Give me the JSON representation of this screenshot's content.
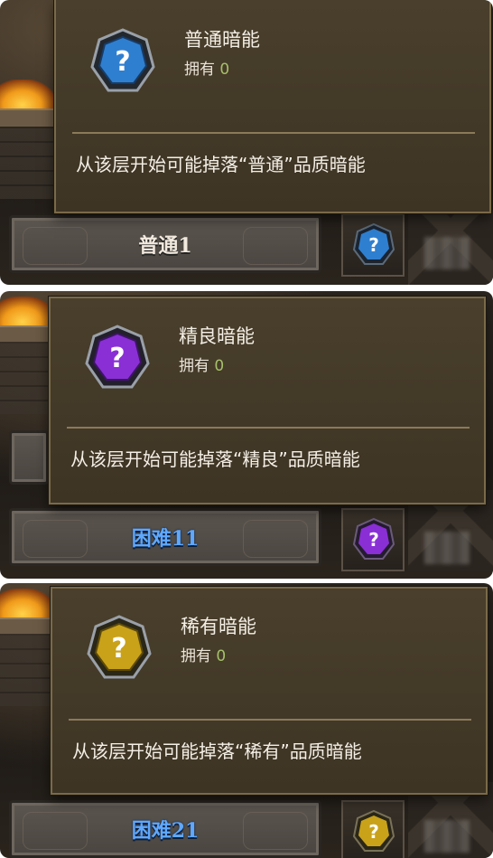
{
  "panels": [
    {
      "tooltip": {
        "name": "普通暗能",
        "own_label": "拥有",
        "own_count": "0",
        "description": "从该层开始可能掉落“普通”品质暗能"
      },
      "level_button": {
        "label": "普通1"
      },
      "gem_color": "#2f7fd0",
      "gem_rim": "#2a3a4e"
    },
    {
      "tooltip": {
        "name": "精良暗能",
        "own_label": "拥有",
        "own_count": "0",
        "description": "从该层开始可能掉落“精良”品质暗能"
      },
      "level_button": {
        "label": "困难11"
      },
      "gem_color": "#8a2fd6",
      "gem_rim": "#3a2a4e"
    },
    {
      "tooltip": {
        "name": "稀有暗能",
        "own_label": "拥有",
        "own_count": "0",
        "description": "从该层开始可能掉落“稀有”品质暗能"
      },
      "level_button": {
        "label": "困难21"
      },
      "gem_color": "#c9a21a",
      "gem_rim": "#4a4228"
    }
  ],
  "icons": {
    "gem": "question-gem-icon"
  }
}
